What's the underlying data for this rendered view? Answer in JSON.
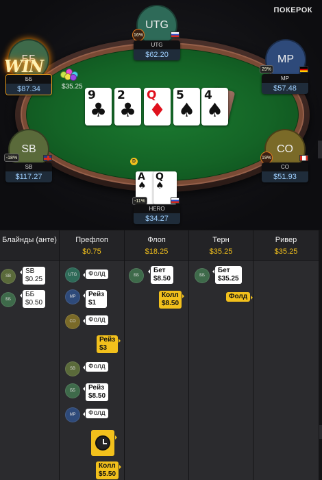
{
  "app": {
    "brand": "ПОКЕРОК"
  },
  "board": [
    {
      "rank": "9",
      "suit": "♣",
      "red": false
    },
    {
      "rank": "2",
      "suit": "♣",
      "red": false
    },
    {
      "rank": "Q",
      "suit": "♦",
      "red": true
    },
    {
      "rank": "5",
      "suit": "♠",
      "red": false
    },
    {
      "rank": "4",
      "suit": "♠",
      "red": false
    }
  ],
  "seats": {
    "utg": {
      "avatar": "UTG",
      "name": "UTG",
      "stack": "$62.20",
      "pct": "16%",
      "flag": "ru"
    },
    "mp": {
      "avatar": "MP",
      "name": "MP",
      "stack": "$57.48",
      "pct": "29%",
      "flag": "de"
    },
    "bb": {
      "avatar": "ББ",
      "name": "ББ",
      "stack": "$87.34",
      "badge": "WIN",
      "chips_amount": "$35.25"
    },
    "sb": {
      "avatar": "SB",
      "name": "SB",
      "stack": "$117.27",
      "pct": "-18%",
      "flag": "gb"
    },
    "co": {
      "avatar": "CO",
      "name": "CO",
      "stack": "$51.93",
      "pct": "19%",
      "flag": "ca"
    },
    "hero": {
      "name": "HERO",
      "stack": "$34.27",
      "pct": "-11%",
      "flag": "ru",
      "cards": [
        {
          "rank": "A",
          "suit": "♠"
        },
        {
          "rank": "Q",
          "suit": "♠"
        }
      ]
    }
  },
  "dealer": "D",
  "history": {
    "columns": [
      {
        "title": "Блайнды (анте)",
        "amount": ""
      },
      {
        "title": "Префлоп",
        "amount": "$0.75"
      },
      {
        "title": "Флоп",
        "amount": "$18.25"
      },
      {
        "title": "Терн",
        "amount": "$35.25"
      },
      {
        "title": "Ривер",
        "amount": "$35.25"
      }
    ],
    "blinds": [
      {
        "pos": "SB",
        "text": "SB",
        "amt": "$0.25"
      },
      {
        "pos": "ББ",
        "text": "ББ",
        "amt": "$0.50"
      }
    ],
    "preflop": {
      "a1": {
        "pos": "UTG",
        "text": "Фолд"
      },
      "a2": {
        "pos": "MP",
        "text": "Рейз",
        "amt": "$1"
      },
      "a3": {
        "pos": "CO",
        "text": "Фолд"
      },
      "a4": {
        "text": "Рейз",
        "amt": "$3"
      },
      "a5": {
        "pos": "SB",
        "text": "Фолд"
      },
      "a6": {
        "pos": "ББ",
        "text": "Рейз",
        "amt": "$8.50"
      },
      "a7": {
        "pos": "MP",
        "text": "Фолд"
      },
      "a8": {
        "text": "Колл",
        "amt": "$5.50"
      }
    },
    "flop": {
      "a1": {
        "pos": "ББ",
        "text": "Бет",
        "amt": "$8.50"
      },
      "a2": {
        "text": "Колл",
        "amt": "$8.50"
      }
    },
    "turn": {
      "a1": {
        "pos": "ББ",
        "text": "Бет",
        "amt": "$35.25"
      },
      "a2": {
        "text": "Фолд"
      }
    }
  }
}
